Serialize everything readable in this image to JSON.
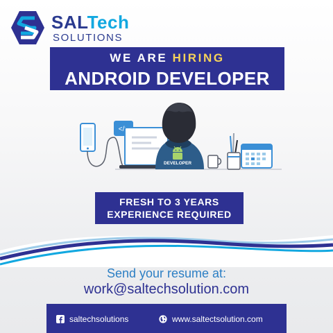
{
  "logo": {
    "brand_part1": "SAL",
    "brand_part2": "Tech",
    "subtitle": "SOLUTIONS"
  },
  "banner": {
    "line1_prefix": "WE ARE ",
    "line1_accent": "HIRING",
    "line2": "ANDROID DEVELOPER"
  },
  "illustration": {
    "code_tag": "</>",
    "badge_label": "DEVELOPER"
  },
  "requirement": {
    "line1": "FRESH TO 3 YEARS",
    "line2": "EXPERIENCE REQUIRED"
  },
  "contact": {
    "label": "Send your resume at:",
    "email": "work@saltechsolution.com"
  },
  "footer": {
    "facebook_handle": "saltechsolutions",
    "website": "www.saltectsolution.com"
  },
  "icons": {
    "logo": "s-shield-logo-icon",
    "facebook": "facebook-icon",
    "website": "globe-icon"
  },
  "colors": {
    "primary_navy": "#2e3192",
    "accent_blue": "#12a8e0",
    "accent_yellow": "#f7d35a",
    "contact_blue": "#2c7fc4"
  }
}
